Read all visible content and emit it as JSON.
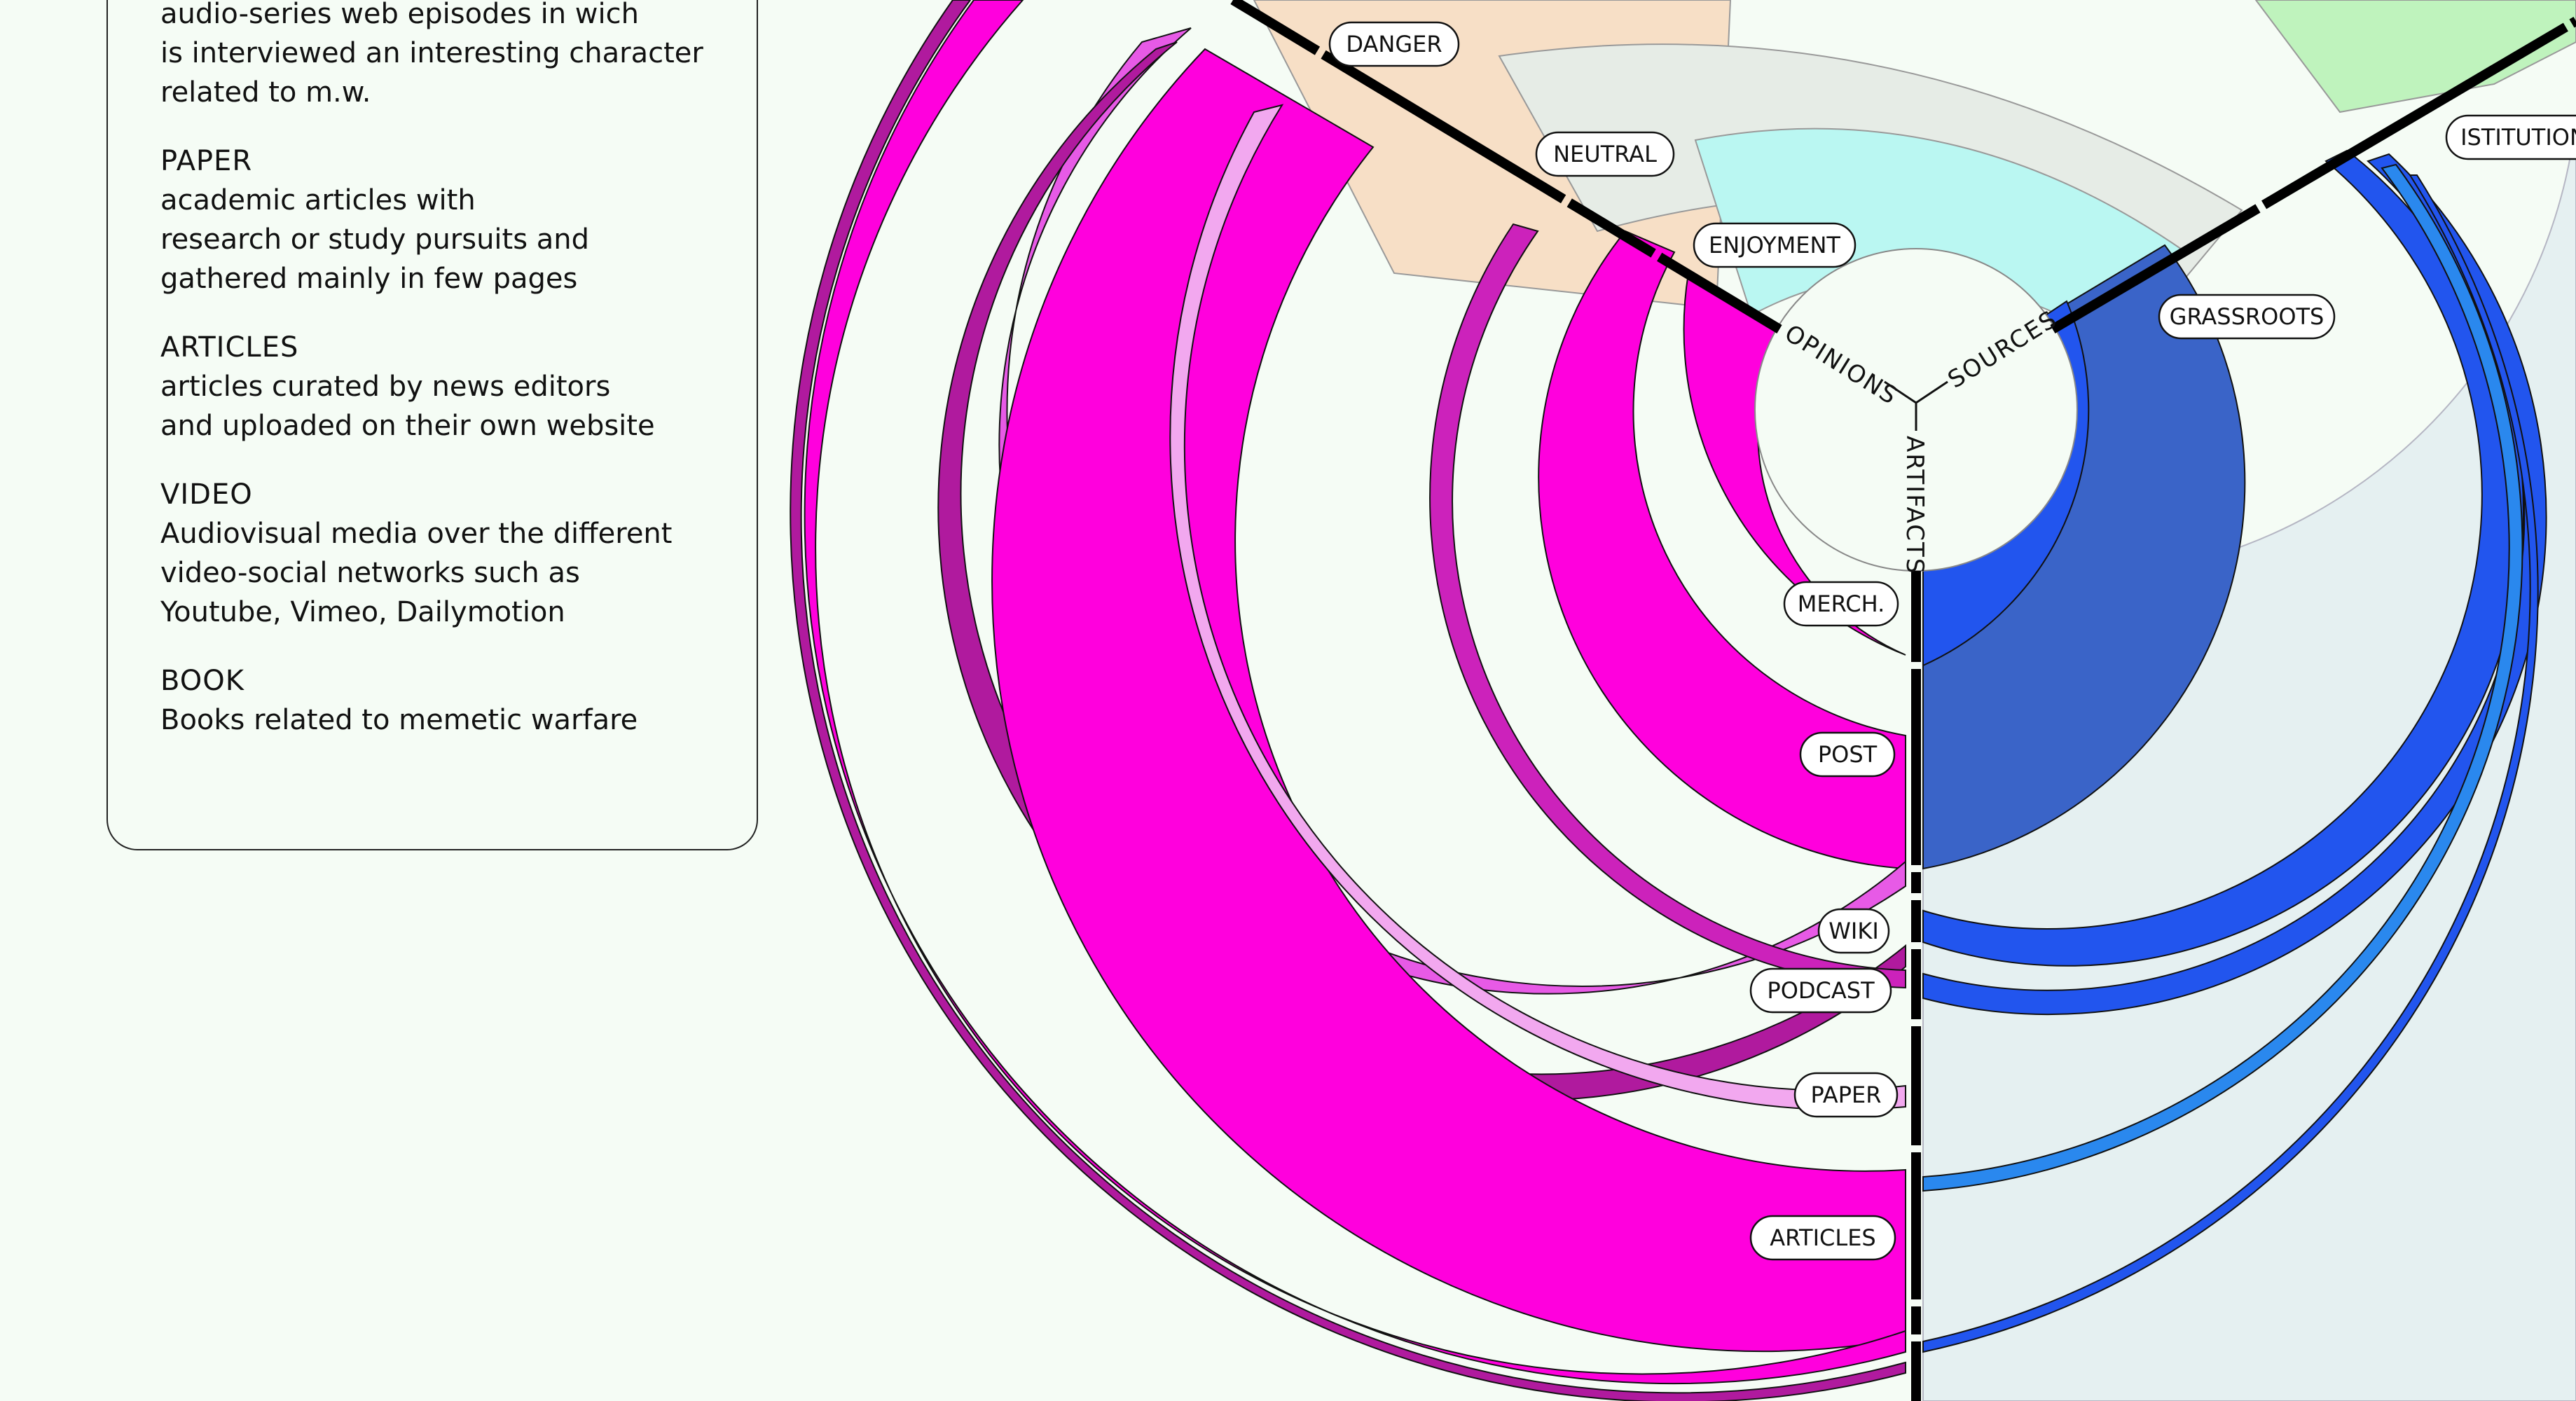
{
  "legend": {
    "entries": [
      {
        "title": "",
        "desc": "audio-series web episodes in wich\nis interviewed an interesting character\nrelated to m.w."
      },
      {
        "title": "PAPER",
        "desc": "academic articles with\nresearch or study pursuits and\ngathered mainly in few pages"
      },
      {
        "title": "ARTICLES",
        "desc": "articles curated by news editors\nand uploaded on their own website"
      },
      {
        "title": "VIDEO",
        "desc": "Audiovisual media over the different\nvideo-social networks such as\nYoutube, Vimeo, Dailymotion"
      },
      {
        "title": "BOOK",
        "desc": "Books related to memetic warfare"
      }
    ]
  },
  "axes": {
    "opinions": "OPINIONS",
    "sources": "SOURCES",
    "artifacts": "ARTIFACTS"
  },
  "labels": {
    "danger": "DANGER",
    "neutral": "NEUTRAL",
    "enjoyment": "ENJOYMENT",
    "grassroots": "GRASSROOTS",
    "istitution": "ISTITUTION",
    "merch": "MERCH.",
    "post": "POST",
    "wiki": "WIKI",
    "podcast": "PODCAST",
    "paper": "PAPER",
    "articles": "ARTICLES"
  },
  "colors": {
    "magenta": "#ff00dd",
    "blue": "#2255ee",
    "danger": "#f7dfc6",
    "neutral": "#e6ece6",
    "enjoyment": "#baf7f2",
    "istitution": "#e3eff1",
    "green": "#bff3bd"
  }
}
